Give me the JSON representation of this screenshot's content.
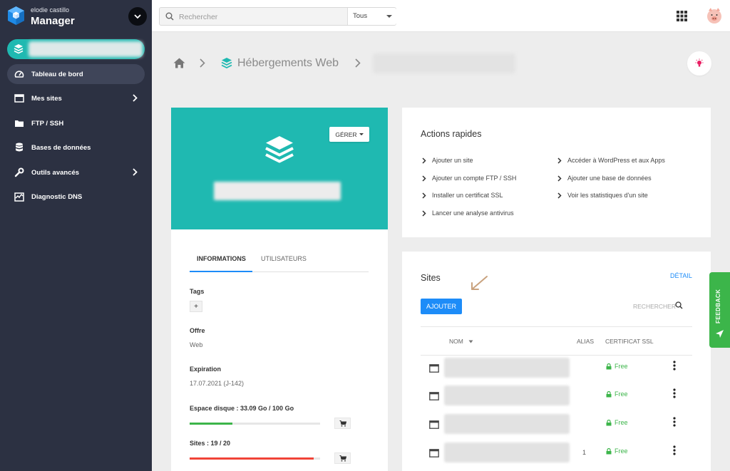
{
  "brand": {
    "user": "elodie castillo",
    "title": "Manager"
  },
  "sidebar": {
    "items": [
      {
        "label": "Tableau de bord"
      },
      {
        "label": "Mes sites"
      },
      {
        "label": "FTP / SSH"
      },
      {
        "label": "Bases de données"
      },
      {
        "label": "Outils avancés"
      },
      {
        "label": "Diagnostic DNS"
      }
    ]
  },
  "topbar": {
    "search_placeholder": "Rechercher",
    "scope": "Tous"
  },
  "breadcrumb": {
    "section": "Hébergements Web"
  },
  "hero": {
    "manage_label": "GÉRER"
  },
  "tabs": {
    "informations": "INFORMATIONS",
    "utilisateurs": "UTILISATEURS"
  },
  "info": {
    "tags_label": "Tags",
    "tag_add": "+",
    "offer_label": "Offre",
    "offer_value": "Web",
    "expiration_label": "Expiration",
    "expiration_value": "17.07.2021 (J-142)",
    "disk_label": "Espace disque : 33.09 Go / 100 Go",
    "disk_usage": 0.33,
    "sites_label": "Sites : 19 / 20",
    "sites_usage": 0.95
  },
  "colors": {
    "teal": "#1fb9b1",
    "sidebar": "#2c3142",
    "primary": "#1d8cf8",
    "success": "#3cb54a",
    "danger": "#f04438"
  },
  "actions": {
    "title": "Actions rapides",
    "left": [
      "Ajouter un site",
      "Ajouter un compte FTP / SSH",
      "Installer un certificat SSL",
      "Lancer une analyse antivirus"
    ],
    "right": [
      "Accéder à WordPress et aux Apps",
      "Ajouter une base de données",
      "Voir les statistiques d'un site"
    ]
  },
  "sites": {
    "title": "Sites",
    "detail": "DÉTAIL",
    "add": "AJOUTER",
    "search_placeholder": "RECHERCHER",
    "columns": {
      "name": "NOM",
      "alias": "ALIAS",
      "ssl": "CERTIFICAT SSL"
    },
    "rows": [
      {
        "alias": "",
        "ssl": "Free"
      },
      {
        "alias": "",
        "ssl": "Free"
      },
      {
        "alias": "",
        "ssl": "Free"
      },
      {
        "alias": "1",
        "ssl": "Free"
      }
    ]
  },
  "feedback": {
    "label": "FEEDBACK"
  }
}
